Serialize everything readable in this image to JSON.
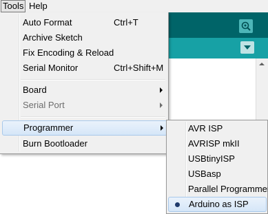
{
  "menubar": {
    "tools_label": "Tools",
    "help_label": "Help"
  },
  "tools_menu": {
    "items": [
      {
        "label": "Auto Format",
        "shortcut": "Ctrl+T"
      },
      {
        "label": "Archive Sketch"
      },
      {
        "label": "Fix Encoding & Reload"
      },
      {
        "label": "Serial Monitor",
        "shortcut": "Ctrl+Shift+M"
      },
      {
        "label": "Board"
      },
      {
        "label": "Serial Port"
      },
      {
        "label": "Programmer"
      },
      {
        "label": "Burn Bootloader"
      }
    ]
  },
  "programmer_submenu": {
    "items": [
      {
        "label": "AVR ISP"
      },
      {
        "label": "AVRISP mkII"
      },
      {
        "label": "USBtinyISP"
      },
      {
        "label": "USBasp"
      },
      {
        "label": "Parallel Programmer"
      },
      {
        "label": "Arduino as ISP",
        "selected": true
      }
    ]
  },
  "icons": {
    "serial_monitor": "magnifier-icon",
    "tab_menu": "triangle-down-icon",
    "submenu_arrow": "chevron-right-icon",
    "selected_marker": "radio-dot-icon"
  },
  "colors": {
    "toolbar": "#006468",
    "tabbar": "#17a1a5",
    "highlight": "#d5e6f8"
  }
}
